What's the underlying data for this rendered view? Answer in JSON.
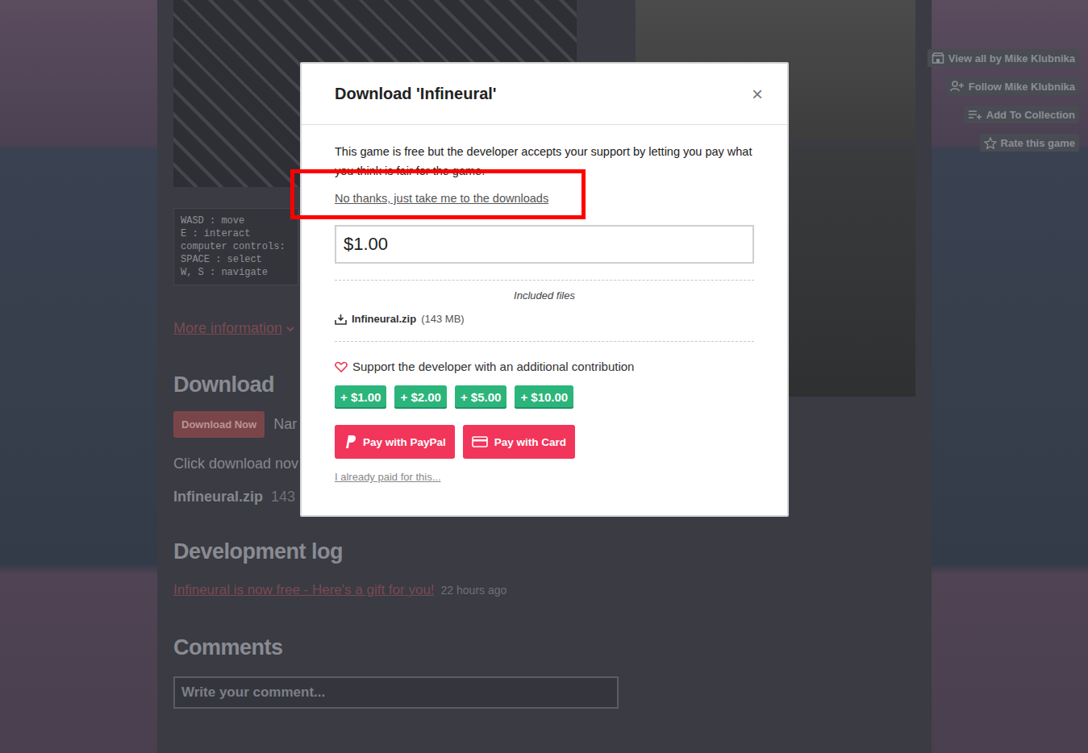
{
  "page": {
    "sidebar_buttons": [
      {
        "label": "View all by Mike Klubnika"
      },
      {
        "label": "Follow Mike Klubnika"
      },
      {
        "label": "Add To Collection"
      },
      {
        "label": "Rate this game"
      }
    ],
    "controls": [
      "WASD : move",
      "E : interact",
      "computer controls:",
      "SPACE : select",
      "W, S : navigate"
    ],
    "more_info": "More information",
    "download_heading": "Download",
    "download_button": "Download Now",
    "price_label": "Nar",
    "click_text": "Click download nov",
    "file": {
      "name": "Infineural.zip",
      "size": "143"
    },
    "devlog_heading": "Development log",
    "devlog_post": {
      "title": "Infineural is now free - Here's a gift for you!",
      "time": "22 hours ago"
    },
    "comments_heading": "Comments",
    "comment_placeholder": "Write your comment..."
  },
  "modal": {
    "title": "Download 'Infineural'",
    "close": "×",
    "message": "This game is free but the developer accepts your support by letting you pay what you think is fair for the game.",
    "skip_link": "No thanks, just take me to the downloads",
    "skip_link_highlighted": true,
    "price": "$1.00",
    "files_label": "Included files",
    "files": [
      {
        "name": "Infineural.zip",
        "size": "(143 MB)"
      }
    ],
    "support_label": "Support the developer with an additional contribution",
    "contributions": [
      "+ $1.00",
      "+ $2.00",
      "+ $5.00",
      "+ $10.00"
    ],
    "pay_buttons": [
      {
        "label": "Pay with PayPal"
      },
      {
        "label": "Pay with Card"
      }
    ],
    "already_paid": "I already paid for this..."
  }
}
